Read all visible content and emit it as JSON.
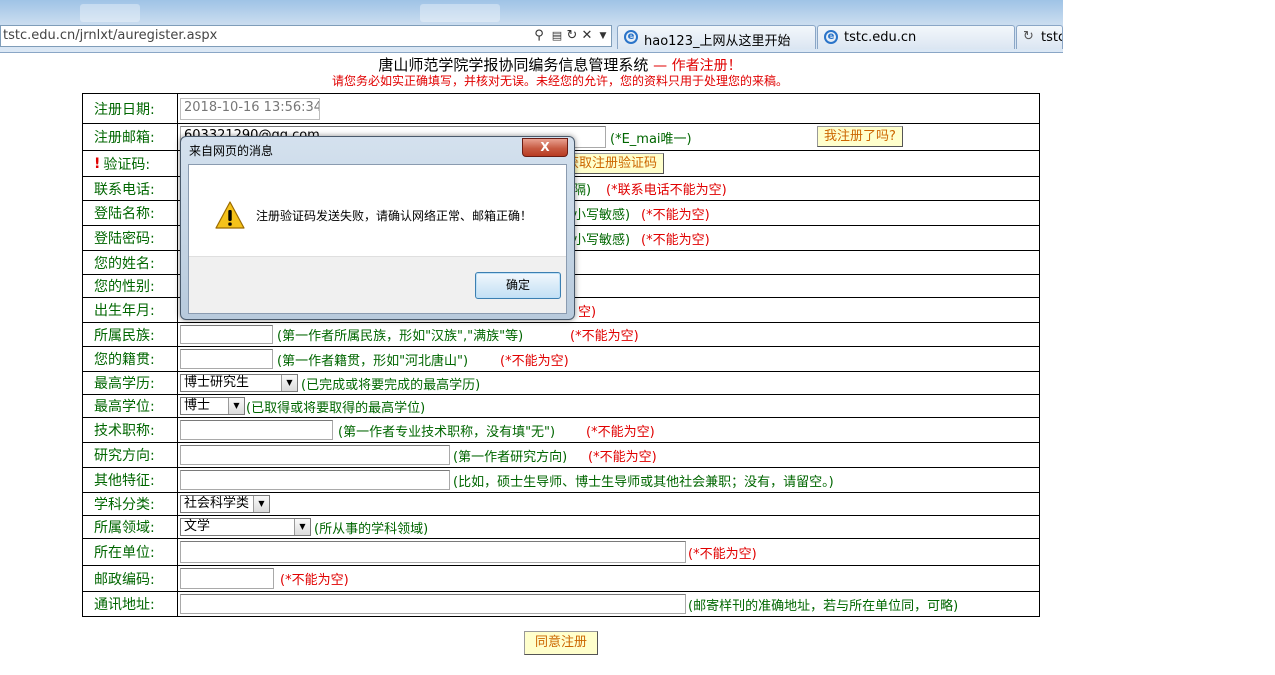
{
  "browser": {
    "address_url": "tstc.edu.cn/jrnlxt/auregister.aspx",
    "tabs": [
      {
        "label": "hao123_上网从这里开始"
      },
      {
        "label": "tstc.edu.cn"
      },
      {
        "label": "tstc"
      }
    ]
  },
  "header": {
    "title": "唐山师范学院学报协同编务信息管理系统",
    "title_suffix": "— 作者注册！",
    "notice": "请您务必如实正确填写，并核对无误。未经您的允许，您的资料只用于处理您的来稿。"
  },
  "form": {
    "reg_date": {
      "label": "注册日期:",
      "value": "2018-10-16 13:56:34"
    },
    "email": {
      "label": "注册邮箱:",
      "value": "603321290@qq.com",
      "hint": "(*E_mai唯一)",
      "check_button": "我注册了吗?"
    },
    "verify_code": {
      "label": "验证码:",
      "required_mark": "!",
      "get_button": "获取注册验证码"
    },
    "phone": {
      "label": "联系电话:",
      "hint_tail": "隔)",
      "req": "(*联系电话不能为空)"
    },
    "login_name": {
      "label": "登陆名称:",
      "hint_tail": "小写敏感)",
      "req": "(*不能为空)"
    },
    "login_password": {
      "label": "登陆密码:",
      "hint_tail": "小写敏感)",
      "req": "(*不能为空)"
    },
    "name": {
      "label": "您的姓名:"
    },
    "gender": {
      "label": "您的性别:"
    },
    "birth": {
      "label": "出生年月:",
      "req_tail": "空)"
    },
    "ethnicity": {
      "label": "所属民族:",
      "hint": "(第一作者所属民族，形如\"汉族\",\"满族\"等)",
      "req": "(*不能为空)"
    },
    "native_place": {
      "label": "您的籍贯:",
      "hint": "(第一作者籍贯，形如\"河北唐山\")",
      "req": "(*不能为空)"
    },
    "education": {
      "label": "最高学历:",
      "selected": "博士研究生",
      "hint": "(已完成或将要完成的最高学历)"
    },
    "degree": {
      "label": "最高学位:",
      "selected": "博士",
      "hint": "(已取得或将要取得的最高学位)"
    },
    "title": {
      "label": "技术职称:",
      "hint": "(第一作者专业技术职称，没有填\"无\")",
      "req": "(*不能为空)"
    },
    "research": {
      "label": "研究方向:",
      "hint": "(第一作者研究方向)",
      "req": "(*不能为空)"
    },
    "other": {
      "label": "其他特征:",
      "hint": "(比如，硕士生导师、博士生导师或其他社会兼职；没有，请留空。)"
    },
    "category": {
      "label": "学科分类:",
      "selected": "社会科学类"
    },
    "field": {
      "label": "所属领域:",
      "selected": "文学",
      "hint": "(所从事的学科领域)"
    },
    "unit": {
      "label": "所在单位:",
      "req": "(*不能为空)"
    },
    "postcode": {
      "label": "邮政编码:",
      "req": "(*不能为空)"
    },
    "address": {
      "label": "通讯地址:",
      "hint": "(邮寄样刊的准确地址，若与所在单位同，可略)"
    }
  },
  "submit_label": "同意注册",
  "dialog": {
    "title": "来自网页的消息",
    "close_label": "X",
    "message": "注册验证码发送失败，请确认网络正常、邮箱正确！",
    "ok_label": "确定",
    "icon": "warning-icon"
  }
}
